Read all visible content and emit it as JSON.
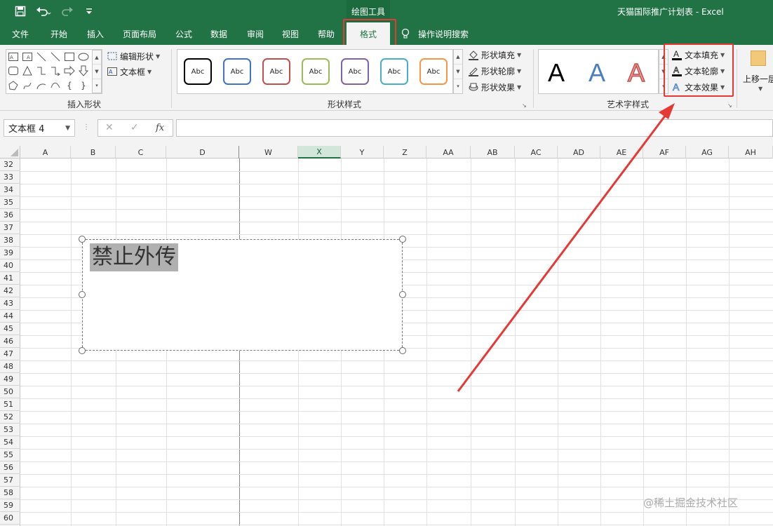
{
  "titlebar": {
    "contextual_label": "绘图工具",
    "doc_title": "天猫国际推广计划表 - Excel",
    "color": "#217346"
  },
  "tabs": [
    "文件",
    "开始",
    "插入",
    "页面布局",
    "公式",
    "数据",
    "审阅",
    "视图",
    "帮助",
    "格式"
  ],
  "tell_me": "操作说明搜索",
  "ribbon": {
    "insert_shapes": {
      "label": "插入形状",
      "edit_shape": "编辑形状",
      "text_box": "文本框"
    },
    "shape_styles": {
      "label": "形状样式",
      "swatch_text": "Abc",
      "swatch_colors": [
        "#000000",
        "#4472c4",
        "#c0504d",
        "#9bbb59",
        "#8064a2",
        "#4bacc6",
        "#f79646"
      ],
      "shape_fill": "形状填充",
      "shape_outline": "形状轮廓",
      "shape_effects": "形状效果"
    },
    "wordart_styles": {
      "label": "艺术字样式",
      "glyph": "A",
      "text_fill": "文本填充",
      "text_outline": "文本轮廓",
      "text_effects": "文本效果"
    },
    "arrange": {
      "bring_forward": "上移一层"
    }
  },
  "formula_bar": {
    "name_box": "文本框 4",
    "cancel": "✕",
    "enter": "✓",
    "fx": "fx",
    "value": ""
  },
  "sheet": {
    "columns": [
      "A",
      "B",
      "C",
      "D",
      "W",
      "X",
      "Y",
      "Z",
      "AA",
      "AB",
      "AC",
      "AD",
      "AE",
      "AF",
      "AG",
      "AH"
    ],
    "selected_column": "X",
    "rows": [
      "32",
      "33",
      "34",
      "35",
      "36",
      "37",
      "38",
      "39",
      "40",
      "41",
      "42",
      "43",
      "44",
      "45",
      "46",
      "47",
      "48",
      "49",
      "50",
      "51",
      "52",
      "53",
      "54",
      "55",
      "56",
      "57",
      "58",
      "59",
      "60"
    ],
    "textbox_text": "禁止外传"
  },
  "watermark": "@稀土掘金技术社区",
  "highlight_color": "#e53935"
}
